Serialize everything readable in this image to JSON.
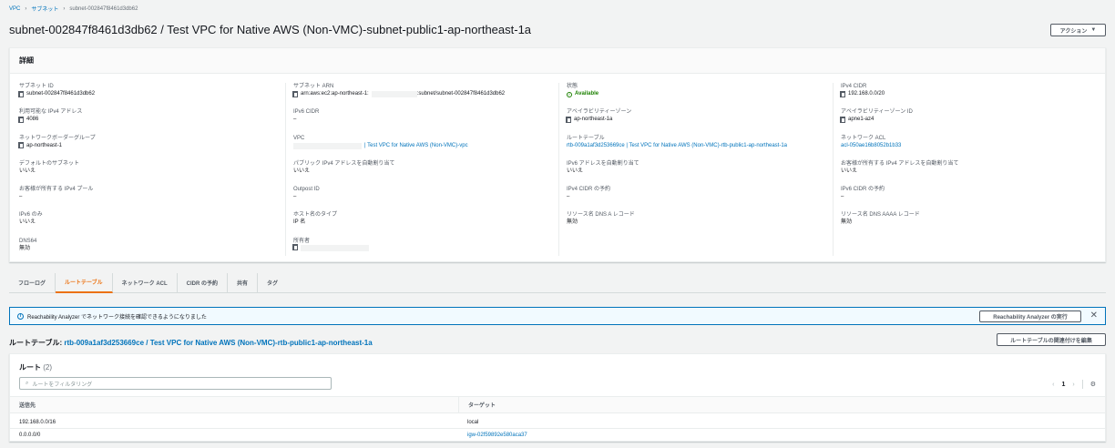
{
  "breadcrumb": {
    "vpc": "VPC",
    "subnets": "サブネット",
    "current": "subnet-002847f8461d3db62"
  },
  "page_title": "subnet-002847f8461d3db62 / Test VPC for Native AWS (Non-VMC)-subnet-public1-ap-northeast-1a",
  "actions_label": "アクション",
  "details": {
    "title": "詳細",
    "subnet_id_label": "サブネット ID",
    "subnet_id": "subnet-002847f8461d3db62",
    "available_ipv4_label": "利用可能な IPv4 アドレス",
    "available_ipv4": "4086",
    "border_group_label": "ネットワークボーダーグループ",
    "border_group": "ap-northeast-1",
    "default_subnet_label": "デフォルトのサブネット",
    "default_subnet": "いいえ",
    "customer_ipv4_pool_label": "お客様が所有する IPv4 プール",
    "customer_ipv4_pool": "–",
    "ipv6_only_label": "IPv6 のみ",
    "ipv6_only": "いいえ",
    "dns64_label": "DNS64",
    "dns64": "無効",
    "subnet_arn_label": "サブネット ARN",
    "subnet_arn_prefix": "arn:aws:ec2:ap-northeast-1:",
    "subnet_arn_suffix": ":subnet/subnet-002847f8461d3db62",
    "ipv6_cidr_label": "IPv6 CIDR",
    "ipv6_cidr": "–",
    "vpc_label": "VPC",
    "vpc": "| Test VPC for Native AWS (Non-VMC)-vpc",
    "auto_assign_public_ipv4_label": "パブリック IPv4 アドレスを自動割り当て",
    "auto_assign_public_ipv4": "いいえ",
    "outpost_id_label": "Outpost ID",
    "outpost_id": "–",
    "hostname_type_label": "ホスト名のタイプ",
    "hostname_type": "IP 名",
    "owner_label": "所有者",
    "state_label": "状態",
    "state": "Available",
    "az_label": "アベイラビリティーゾーン",
    "az": "ap-northeast-1a",
    "route_table_label": "ルートテーブル",
    "route_table": "rtb-009a1af3d253669ce | Test VPC for Native AWS (Non-VMC)-rtb-public1-ap-northeast-1a",
    "auto_assign_ipv6_label": "IPv6 アドレスを自動割り当て",
    "auto_assign_ipv6": "いいえ",
    "ipv4_cidr_reservation_label": "IPv4 CIDR の予約",
    "ipv4_cidr_reservation": "–",
    "dns_a_label": "リソース名 DNS A レコード",
    "dns_a": "無効",
    "ipv4_cidr_label": "IPv4 CIDR",
    "ipv4_cidr": "192.168.0.0/20",
    "az_id_label": "アベイラビリティーゾーン ID",
    "az_id": "apne1-az4",
    "network_acl_label": "ネットワーク ACL",
    "network_acl": "acl-050ae16b8052b1b33",
    "customer_auto_ipv4_label": "お客様が所有する IPv4 アドレスを自動割り当て",
    "customer_auto_ipv4": "いいえ",
    "ipv6_cidr_reservation_label": "IPv6 CIDR の予約",
    "ipv6_cidr_reservation": "–",
    "dns_aaaa_label": "リソース名 DNS AAAA レコード",
    "dns_aaaa": "無効"
  },
  "tabs": [
    "フローログ",
    "ルートテーブル",
    "ネットワーク ACL",
    "CIDR の予約",
    "共有",
    "タグ"
  ],
  "flash": {
    "text": "Reachability Analyzer でネットワーク接続を確認できるようになりました",
    "button": "Reachability Analyzer の実行"
  },
  "route_table_section": {
    "label": "ルートテーブル: ",
    "link": "rtb-009a1af3d253669ce / Test VPC for Native AWS (Non-VMC)-rtb-public1-ap-northeast-1a",
    "edit_button": "ルートテーブルの関連付けを編集"
  },
  "routes": {
    "title": "ルート",
    "count": "(2)",
    "search_placeholder": "ルートをフィルタリング",
    "page": "1",
    "columns": [
      "送信先",
      "ターゲット"
    ],
    "rows": [
      {
        "destination": "192.168.0.0/16",
        "target": "local"
      },
      {
        "destination": "0.0.0.0/0",
        "target": "igw-02f59892e580aca37"
      }
    ]
  }
}
